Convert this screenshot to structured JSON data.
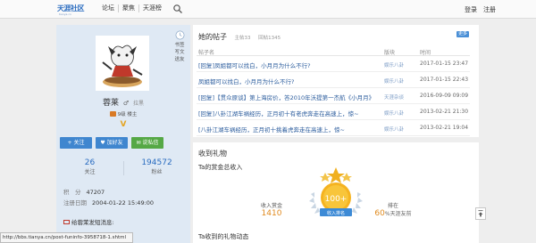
{
  "nav": {
    "logo_text": "天涯社区",
    "logo_sub": "tianya.cn",
    "items": [
      "论坛",
      "聚焦",
      "天涯榜"
    ],
    "login": "登录",
    "register": "注册"
  },
  "profile": {
    "side_links": [
      "书签",
      "写文",
      "送友"
    ],
    "username": "蓉莱",
    "gender": "♂",
    "status": "拉黑",
    "badge": "9级 楼主",
    "v_mark": "V",
    "follow_btn": "+ 关注",
    "friend_btn": "♥ 加好友",
    "message_btn": "✉ 说私信",
    "stats": [
      {
        "num": "26",
        "label": "关注"
      },
      {
        "num": "194572",
        "label": "粉丝"
      }
    ],
    "score_label": "积　分",
    "score_value": "47207",
    "reg_label": "注册日期",
    "reg_value": "2004-01-22 15:49:00",
    "send_msg": "给蓉茉发短消息:"
  },
  "posts": {
    "title": "她的帖子",
    "meta_a": "主帖33",
    "meta_b": "回帖1345",
    "more": "更多",
    "headers": {
      "title": "帖子名",
      "board": "版块",
      "time": "时间"
    },
    "rows": [
      {
        "title": "[回复]凤姐都可以找白，小月月为什么不行?",
        "board": "娱乐八卦",
        "time": "2017-01-15 23:47"
      },
      {
        "title": "凤姐都可以找白，小月月为什么不行?",
        "board": "娱乐八卦",
        "time": "2017-01-15 22:43"
      },
      {
        "title": "[回复]【贯众原谈】第上海房价，答2010年沃提第一杰航《小月月》",
        "board": "天涯杂谈",
        "time": "2016-09-09 09:09"
      },
      {
        "title": "[回复]八卦江湖车祸经历，正月初十有老虎奔走在高速上，惊~",
        "board": "娱乐八卦",
        "time": "2013-02-21 21:30"
      },
      {
        "title": "[八卦江湖车祸经历，正月初十挑着虎奔走在高速上，惊~",
        "board": "娱乐八卦",
        "time": "2013-02-21 19:04"
      }
    ]
  },
  "gifts": {
    "title": "收到礼物",
    "subtitle": "Ta的赏金总收入",
    "income_label": "收入赏金",
    "income_value": "1410",
    "rank_value": "100+",
    "rank_label": "收入排名",
    "rank_right_label": "排在",
    "rank_right_value": "60",
    "rank_right_suffix": "%天涯友前",
    "received_title": "Ta收到的礼物动态"
  },
  "statusbar": {
    "url": "http://bbs.tianya.cn/post-funinfo-3958718-1.shtml"
  },
  "colors": {
    "accent_blue": "#3f86cf",
    "accent_green": "#55a845",
    "link_blue": "#2b5c9d",
    "gold": "#e08a1e"
  }
}
